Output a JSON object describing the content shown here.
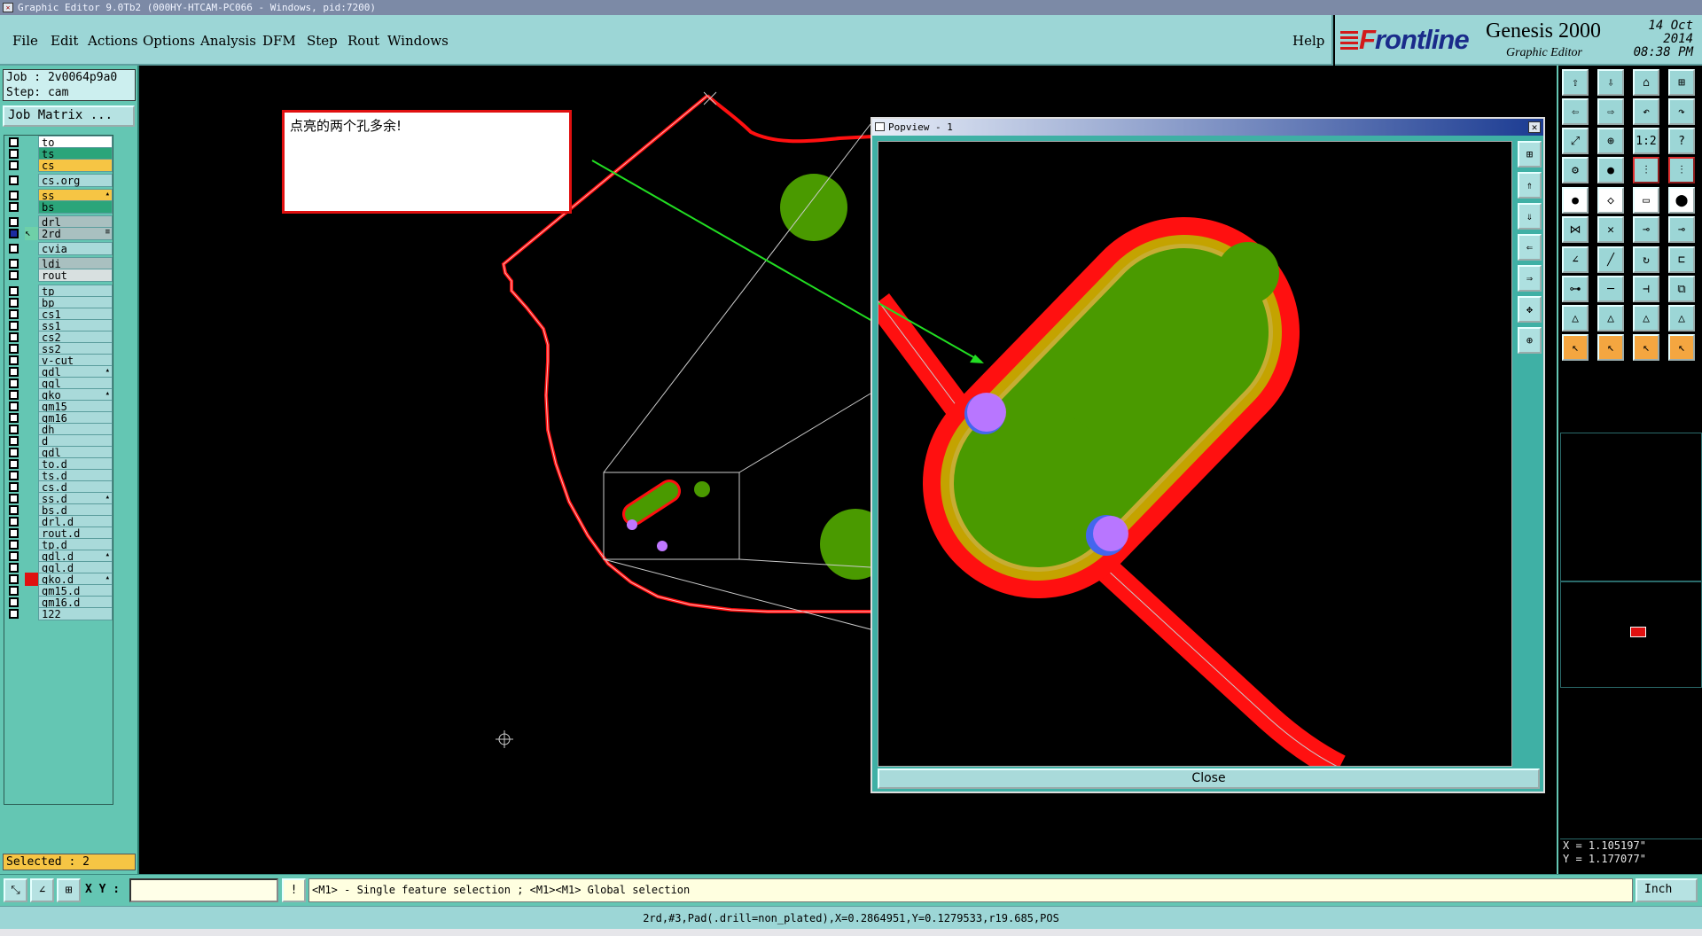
{
  "window": {
    "title": "Graphic Editor 9.0Tb2 (000HY-HTCAM-PC066 - Windows, pid:7200)"
  },
  "menu": {
    "items": [
      "File",
      "Edit",
      "Actions",
      "Options",
      "Analysis",
      "DFM",
      "Step",
      "Rout",
      "Windows"
    ],
    "help": "Help"
  },
  "brand": {
    "logo_f": "F",
    "logo_rest": "rontline",
    "product": "Genesis 2000",
    "subtitle": "Graphic Editor",
    "date": "14 Oct 2014",
    "time": "08:38 PM"
  },
  "job": {
    "job_line": "Job : 2v0064p9a0",
    "step_line": "Step: cam",
    "matrix_button": "Job Matrix ..."
  },
  "layers": [
    {
      "name": "to",
      "color": "#ffffff"
    },
    {
      "name": "ts",
      "color": "#2ba57a"
    },
    {
      "name": "cs",
      "color": "#f6c544"
    },
    {
      "name": "cs.org",
      "color": "#a9dada"
    },
    {
      "name": "ss",
      "color": "#f6c544",
      "ext": "▴"
    },
    {
      "name": "bs",
      "color": "#2ba57a"
    },
    {
      "name": "drl",
      "color": "#a9c0c0"
    },
    {
      "name": "2rd",
      "color": "#a9c0c0",
      "ext": "≡",
      "active": true
    },
    {
      "name": "cvia",
      "color": "#a9dada"
    },
    {
      "name": "ldi",
      "color": "#a9c0c0"
    },
    {
      "name": "rout",
      "color": "#d8e0e0"
    },
    {
      "name": "tp",
      "color": "#a9dada"
    },
    {
      "name": "bp",
      "color": "#a9dada"
    },
    {
      "name": "cs1",
      "color": "#a9dada"
    },
    {
      "name": "ss1",
      "color": "#a9dada"
    },
    {
      "name": "cs2",
      "color": "#a9dada"
    },
    {
      "name": "ss2",
      "color": "#a9dada"
    },
    {
      "name": "v-cut",
      "color": "#a9dada"
    },
    {
      "name": "gdl",
      "color": "#a9dada",
      "ext": "▴"
    },
    {
      "name": "ggl",
      "color": "#a9dada"
    },
    {
      "name": "gko",
      "color": "#a9dada",
      "ext": "▴"
    },
    {
      "name": "gm15",
      "color": "#a9dada"
    },
    {
      "name": "gm16",
      "color": "#a9dada"
    },
    {
      "name": "dh",
      "color": "#a9dada"
    },
    {
      "name": "d",
      "color": "#a9dada"
    },
    {
      "name": "gdl",
      "color": "#a9dada"
    },
    {
      "name": "to.d",
      "color": "#a9dada"
    },
    {
      "name": "ts.d",
      "color": "#a9dada"
    },
    {
      "name": "cs.d",
      "color": "#a9dada"
    },
    {
      "name": "ss.d",
      "color": "#a9dada",
      "ext": "▴"
    },
    {
      "name": "bs.d",
      "color": "#a9dada"
    },
    {
      "name": "drl.d",
      "color": "#a9dada"
    },
    {
      "name": "rout.d",
      "color": "#a9dada"
    },
    {
      "name": "tp.d",
      "color": "#a9dada"
    },
    {
      "name": "gdl.d",
      "color": "#a9dada",
      "ext": "▴"
    },
    {
      "name": "ggl.d",
      "color": "#a9dada"
    },
    {
      "name": "gko.d",
      "color": "#a9dada",
      "ext": "▴",
      "marker": "#e01010"
    },
    {
      "name": "gm15.d",
      "color": "#a9dada"
    },
    {
      "name": "gm16.d",
      "color": "#a9dada"
    },
    {
      "name": "122",
      "color": "#a9dada"
    }
  ],
  "selected": "Selected : 2",
  "note": {
    "text": "点亮的两个孔多余!"
  },
  "popview": {
    "title": "Popview - 1",
    "close_label": "Close"
  },
  "coords": {
    "x": "X = 1.105197\"",
    "y": "Y = 1.177077\""
  },
  "bottom": {
    "xy_label": "X Y :",
    "xy_value": "",
    "message": "<M1> - Single feature selection ; <M1><M1> Global selection",
    "unit": "Inch"
  },
  "status": "2rd,#3,Pad(.drill=non_plated),X=0.2864951,Y=0.1279533,r19.685,POS",
  "colors": {
    "panel": "#64c6b3",
    "menubar": "#9cd6d6",
    "outline_red": "#ff1010",
    "pad_green": "#4a9a00",
    "hole_violet": "#bf77ff",
    "hole_blue": "#4466ee",
    "arrow_green": "#22dd22"
  }
}
